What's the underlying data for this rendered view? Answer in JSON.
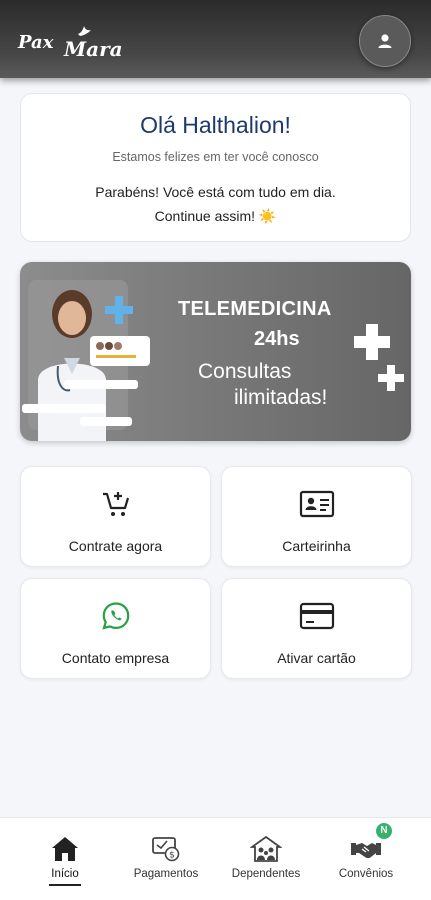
{
  "header": {
    "logo_word1": "Pax",
    "logo_word2": "Mara"
  },
  "greeting": {
    "title": "Olá Halthalion!",
    "subtitle": "Estamos felizes em ter você conosco",
    "message_line1": "Parabéns! Você está com tudo em dia.",
    "message_line2": "Continue assim! ☀️"
  },
  "banner": {
    "line1": "TELEMEDICINA",
    "line2": "24hs",
    "line3": "Consultas",
    "line4": "ilimitadas!"
  },
  "tiles": [
    {
      "label": "Contrate agora",
      "icon": "cart-plus-icon"
    },
    {
      "label": "Carteirinha",
      "icon": "id-card-icon"
    },
    {
      "label": "Contato empresa",
      "icon": "whatsapp-icon"
    },
    {
      "label": "Ativar cartão",
      "icon": "credit-card-icon"
    }
  ],
  "nav": [
    {
      "label": "Início",
      "icon": "home-icon",
      "active": true
    },
    {
      "label": "Pagamentos",
      "icon": "payments-icon",
      "active": false
    },
    {
      "label": "Dependentes",
      "icon": "family-icon",
      "active": false
    },
    {
      "label": "Convênios",
      "icon": "handshake-icon",
      "active": false,
      "badge": "N"
    }
  ],
  "colors": {
    "title_blue": "#1c3b6c",
    "whatsapp_green": "#25a244",
    "badge_green": "#35b36b",
    "banner_cross": "#ffffff"
  }
}
